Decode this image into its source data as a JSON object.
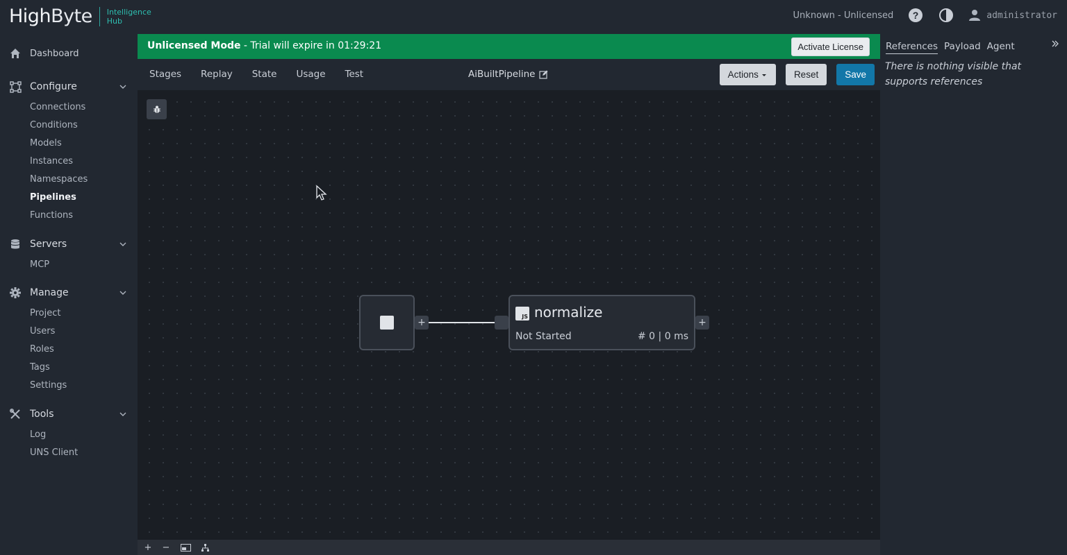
{
  "app": {
    "logo_text_1": "High",
    "logo_text_2": "Byte",
    "logo_sub_1": "Intelligence",
    "logo_sub_2": "Hub",
    "license_status": "Unknown - Unlicensed",
    "username": "administrator",
    "icons": {
      "help": "help-icon",
      "theme": "contrast-icon",
      "user": "user-icon"
    }
  },
  "sidebar": {
    "dashboard": "Dashboard",
    "sections": [
      {
        "label": "Configure",
        "items": [
          "Connections",
          "Conditions",
          "Models",
          "Instances",
          "Namespaces",
          "Pipelines",
          "Functions"
        ],
        "active": "Pipelines"
      },
      {
        "label": "Servers",
        "items": [
          "MCP"
        ]
      },
      {
        "label": "Manage",
        "items": [
          "Project",
          "Users",
          "Roles",
          "Tags",
          "Settings"
        ]
      },
      {
        "label": "Tools",
        "items": [
          "Log",
          "UNS Client"
        ]
      }
    ]
  },
  "banner": {
    "mode": "Unlicensed Mode",
    "message": " - Trial will expire in 01:29:21",
    "activate_label": "Activate License",
    "color": "#0a8a4f"
  },
  "toolbar": {
    "tabs": [
      "Stages",
      "Replay",
      "State",
      "Usage",
      "Test"
    ],
    "pipeline_name": "AiBuiltPipeline",
    "actions_label": "Actions",
    "reset_label": "Reset",
    "save_label": "Save"
  },
  "canvas": {
    "fn_node": {
      "badge": "JS",
      "name": "normalize",
      "status": "Not Started",
      "stats": "# 0 | 0 ms"
    },
    "port_plus": "+"
  },
  "bottombar": {
    "zoom_in": "+",
    "zoom_out": "−"
  },
  "rpanel": {
    "tabs": [
      "References",
      "Payload",
      "Agent"
    ],
    "active_tab": "References",
    "empty_message": "There is nothing visible that supports references"
  }
}
